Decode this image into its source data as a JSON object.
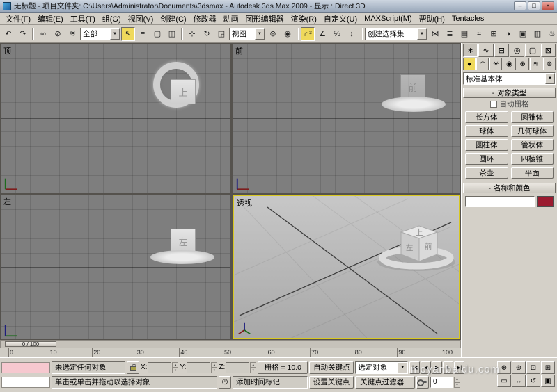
{
  "window": {
    "title": "无标题 - 项目文件夹: C:\\Users\\Administrator\\Documents\\3dsmax    - Autodesk 3ds Max  2009    - 显示 : Direct 3D",
    "buttons": {
      "minimize": "–",
      "maximize": "□",
      "close": "×"
    }
  },
  "icons": {
    "dropdown_arrow": "▼",
    "spinner_up": "▲",
    "spinner_down": "▼",
    "clock": "◷",
    "minus": "-"
  },
  "menu": {
    "items": [
      "文件(F)",
      "编辑(E)",
      "工具(T)",
      "组(G)",
      "视图(V)",
      "创建(C)",
      "修改器",
      "动画",
      "图形编辑器",
      "渲染(R)",
      "自定义(U)",
      "MAXScript(M)",
      "帮助(H)",
      "Tentacles"
    ]
  },
  "toolbar": {
    "g1": [
      {
        "name": "undo-icon",
        "g": "↶"
      },
      {
        "name": "redo-icon",
        "g": "↷"
      }
    ],
    "g2": [
      {
        "name": "select-and-link-icon",
        "g": "∞"
      },
      {
        "name": "unlink-selection-icon",
        "g": "⊘"
      },
      {
        "name": "bind-to-spacewarp-icon",
        "g": "≋"
      }
    ],
    "selection_filter": "全部",
    "g3": [
      {
        "name": "select-object-icon",
        "g": "↖",
        "hl": true
      },
      {
        "name": "select-by-name-icon",
        "g": "≡"
      },
      {
        "name": "selection-region-icon",
        "g": "▢"
      },
      {
        "name": "window-crossing-icon",
        "g": "◫"
      }
    ],
    "g4": [
      {
        "name": "move-icon",
        "g": "⊹"
      },
      {
        "name": "rotate-icon",
        "g": "↻"
      },
      {
        "name": "scale-icon",
        "g": "◲"
      }
    ],
    "ref_coord": "视图",
    "g5": [
      {
        "name": "use-center-icon",
        "g": "⊙"
      },
      {
        "name": "select-manipulate-icon",
        "g": "◉"
      }
    ],
    "g6": [
      {
        "name": "snaps-toggle-icon",
        "g": "∩³",
        "hl": true
      },
      {
        "name": "angle-snap-icon",
        "g": "∠"
      },
      {
        "name": "percent-snap-icon",
        "g": "%"
      },
      {
        "name": "spinner-snap-icon",
        "g": "↕"
      }
    ],
    "named_sets": "创建选择集",
    "g7": [
      {
        "name": "mirror-icon",
        "g": "⋈"
      },
      {
        "name": "align-icon",
        "g": "≣"
      },
      {
        "name": "layer-manager-icon",
        "g": "▤"
      },
      {
        "name": "curve-editor-icon",
        "g": "≈"
      },
      {
        "name": "schematic-view-icon",
        "g": "⊞"
      },
      {
        "name": "material-editor-icon",
        "g": "◑"
      },
      {
        "name": "render-setup-icon",
        "g": "▣"
      },
      {
        "name": "render-frame-icon",
        "g": "▥"
      },
      {
        "name": "quick-render-icon",
        "g": "♨"
      }
    ]
  },
  "viewports": {
    "top": {
      "label": "顶",
      "cube": "上"
    },
    "front": {
      "label": "前",
      "cube": "前"
    },
    "left": {
      "label": "左",
      "cube": "左"
    },
    "perspective": {
      "label": "透视",
      "cube_top": "上",
      "cube_left": "左",
      "cube_front": "前"
    }
  },
  "command_panel": {
    "tabs": [
      {
        "name": "tab-create",
        "g": "∗",
        "hl": true
      },
      {
        "name": "tab-modify",
        "g": "∿"
      },
      {
        "name": "tab-hierarchy",
        "g": "⊟"
      },
      {
        "name": "tab-motion",
        "g": "◎"
      },
      {
        "name": "tab-display",
        "g": "▢"
      },
      {
        "name": "tab-utilities",
        "g": "⊠"
      }
    ],
    "subtabs": [
      {
        "name": "geometry-icon",
        "g": "●",
        "hl": true
      },
      {
        "name": "shapes-icon",
        "g": "◠"
      },
      {
        "name": "lights-icon",
        "g": "☀"
      },
      {
        "name": "cameras-icon",
        "g": "◉"
      },
      {
        "name": "helpers-icon",
        "g": "⊕"
      },
      {
        "name": "spacewarps-icon",
        "g": "≋"
      },
      {
        "name": "systems-icon",
        "g": "⊛"
      }
    ],
    "category_dropdown": "标准基本体",
    "object_type_rollout": "对象类型",
    "autogrid_label": "自动栅格",
    "object_buttons": [
      "长方体",
      "圆锥体",
      "球体",
      "几何球体",
      "圆柱体",
      "管状体",
      "圆环",
      "四棱锥",
      "茶壶",
      "平面"
    ],
    "name_color_rollout": "名称和颜色",
    "object_name": "",
    "object_color": "#9b1b30"
  },
  "timeline": {
    "slider_label": "0 / 100",
    "ticks": [
      "0",
      "10",
      "20",
      "30",
      "40",
      "50",
      "60",
      "70",
      "80",
      "90",
      "100"
    ]
  },
  "status_bar": {
    "status_line": "未选定任何对象",
    "prompt_line": "单击或单击并拖动以选择对象",
    "x_label": "X:",
    "y_label": "Y:",
    "z_label": "Z:",
    "x_value": "",
    "y_value": "",
    "z_value": "",
    "grid_size": "栅格 = 10.0",
    "add_time_tag": "添加时间标记",
    "auto_key": "自动关键点",
    "set_key": "设置关键点",
    "key_mode_selected": "选定对象",
    "key_filters": "关键点过滤器...",
    "current_frame": "0",
    "playback": [
      {
        "name": "go-to-start-icon",
        "g": "|◀"
      },
      {
        "name": "previous-frame-icon",
        "g": "◀"
      },
      {
        "name": "play-icon",
        "g": "▶"
      },
      {
        "name": "next-frame-icon",
        "g": "▶"
      },
      {
        "name": "go-to-end-icon",
        "g": "▶|"
      }
    ],
    "nav": [
      {
        "name": "zoom-icon",
        "g": "⊕"
      },
      {
        "name": "zoom-all-icon",
        "g": "⊛"
      },
      {
        "name": "zoom-extents-icon",
        "g": "⊡"
      },
      {
        "name": "zoom-extents-all-icon",
        "g": "⊞"
      },
      {
        "name": "field-of-view-icon",
        "g": "▭"
      },
      {
        "name": "pan-icon",
        "g": "↔"
      },
      {
        "name": "arc-rotate-icon",
        "g": "↺"
      },
      {
        "name": "maximize-viewport-icon",
        "g": "▣"
      }
    ]
  },
  "watermark": "moyanbaidu.com"
}
